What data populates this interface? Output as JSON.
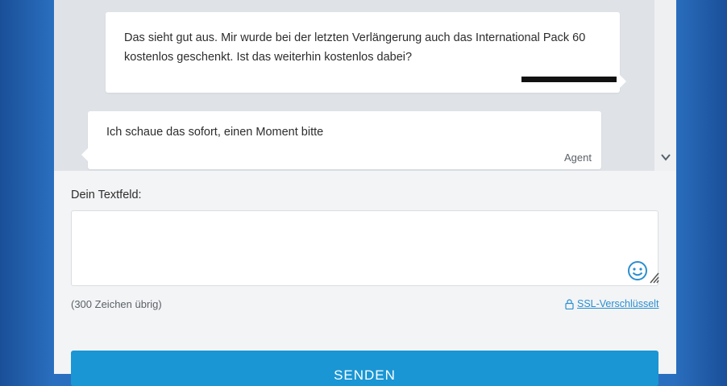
{
  "chat": {
    "messages": [
      {
        "role": "user",
        "text": "Das sieht gut aus. Mir wurde bei der letzten Verlängerung auch das International Pack 60 kostenlos geschenkt. Ist das weiterhin kostenlos dabei?"
      },
      {
        "role": "agent",
        "text": "Ich schaue das sofort, einen Moment bitte",
        "sender": "Agent"
      }
    ]
  },
  "form": {
    "label": "Dein Textfeld:",
    "input_value": "",
    "counter": "(300 Zeichen übrig)",
    "ssl_label": "SSL-Verschlüsselt",
    "send_label": "SENDEN"
  },
  "icons": {
    "emoji": "smiley-icon",
    "lock": "lock-icon",
    "scroll": "chevron-down-icon",
    "resize": "resize-grip-icon"
  },
  "colors": {
    "accent": "#1a96d4",
    "link": "#2a8fd0",
    "chat_background": "#dfe3e7",
    "page_background": "#2a6fbf"
  }
}
